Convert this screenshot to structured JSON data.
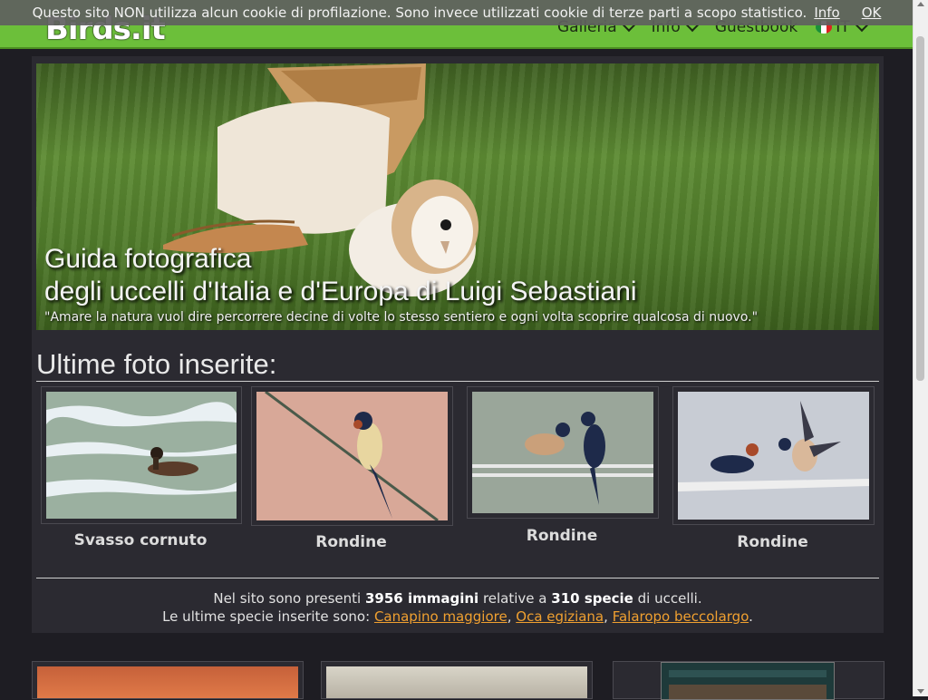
{
  "cookie_banner": {
    "text": "Questo sito NON utilizza alcun cookie di profilazione. Sono invece utilizzati cookie di terze parti a scopo statistico.",
    "info_label": "Info",
    "ok_label": "OK"
  },
  "navbar": {
    "logo_text": "Birds.it",
    "items": [
      {
        "label": "Galleria",
        "dropdown": true
      },
      {
        "label": "Info",
        "dropdown": true
      },
      {
        "label": "Guestbook",
        "dropdown": false
      }
    ],
    "language": {
      "label": "IT",
      "flag": "italy-flag-icon"
    }
  },
  "hero": {
    "title_line1": "Guida fotografica",
    "title_line2": "degli uccelli d'Italia e d'Europa di Luigi Sebastiani",
    "quote": "\"Amare la natura vuol dire percorrere decine di volte lo stesso sentiero e ogni volta scoprire qualcosa di nuovo.\""
  },
  "latest": {
    "title": "Ultime foto inserite:",
    "photos": [
      {
        "caption": "Svasso cornuto"
      },
      {
        "caption": "Rondine"
      },
      {
        "caption": "Rondine"
      },
      {
        "caption": "Rondine"
      }
    ]
  },
  "stats": {
    "prefix": "Nel sito sono presenti",
    "images": "3956 immagini",
    "middle": "relative a",
    "species": "310 specie",
    "suffix": "di uccelli.",
    "latest_prefix": "Le ultime specie inserite sono:",
    "latest_species": [
      "Canapino maggiore",
      "Oca egiziana",
      "Falaropo beccolargo"
    ],
    "sep": ",",
    "end": "."
  },
  "colors": {
    "navbar": "#6cbf3a",
    "background": "#1e1d23",
    "panel": "#2b2a31",
    "link": "#f0a030"
  }
}
